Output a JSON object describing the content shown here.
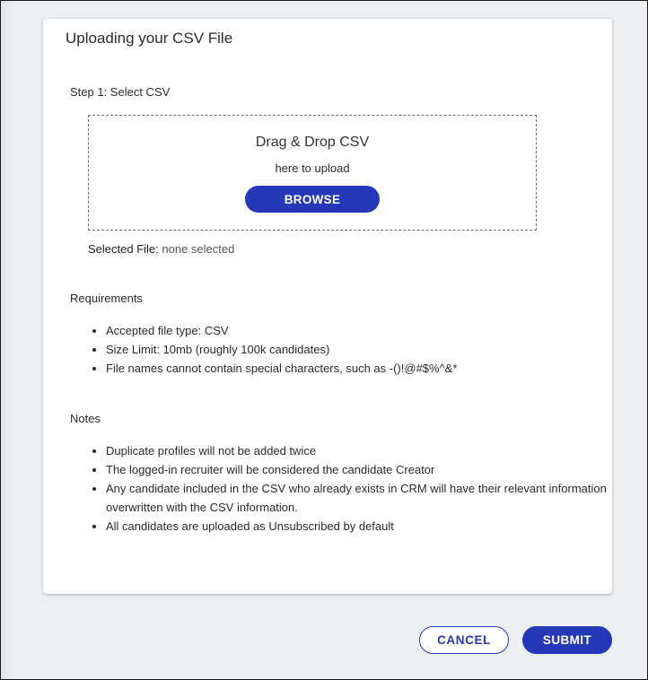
{
  "dialog": {
    "title": "Uploading your CSV File",
    "step_label": "Step 1: Select CSV",
    "dropzone": {
      "title": "Drag & Drop CSV",
      "subtitle": "here to upload",
      "browse_label": "BROWSE"
    },
    "selected_file": {
      "label": "Selected File:",
      "value": "none selected"
    },
    "requirements": {
      "heading": "Requirements",
      "items": [
        "Accepted file type: CSV",
        "Size Limit: 10mb (roughly 100k candidates)",
        "File names cannot contain special characters, such as -()!@#$%^&*"
      ]
    },
    "notes": {
      "heading": "Notes",
      "items": [
        "Duplicate profiles will not be added twice",
        "The logged-in recruiter will be considered the candidate Creator",
        "Any candidate included in the CSV who already exists in CRM will have their relevant information overwritten with the CSV information.",
        "All candidates are uploaded as Unsubscribed by default"
      ]
    }
  },
  "footer": {
    "cancel_label": "CANCEL",
    "submit_label": "SUBMIT"
  },
  "colors": {
    "primary": "#2438b8",
    "background": "#edf0f2",
    "card": "#ffffff"
  }
}
